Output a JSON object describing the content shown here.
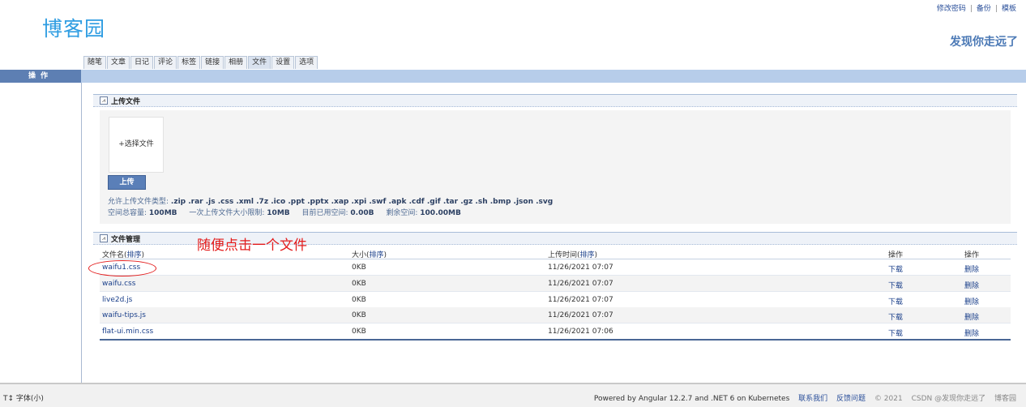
{
  "header": {
    "logo": "博客园",
    "links": [
      "修改密码",
      "备份",
      "模板"
    ],
    "slogan": "发现你走远了"
  },
  "tabs": [
    {
      "label": "随笔",
      "active": false
    },
    {
      "label": "文章",
      "active": false
    },
    {
      "label": "日记",
      "active": false
    },
    {
      "label": "评论",
      "active": false
    },
    {
      "label": "标签",
      "active": false
    },
    {
      "label": "链接",
      "active": false
    },
    {
      "label": "相册",
      "active": false
    },
    {
      "label": "文件",
      "active": true
    },
    {
      "label": "设置",
      "active": false
    },
    {
      "label": "选项",
      "active": false
    }
  ],
  "sidebar": {
    "heading": "操作"
  },
  "upload": {
    "section_title": "上传文件",
    "toggle_icon": "collapse-icon",
    "pick_label": "+选择文件",
    "upload_button": "上传",
    "allowed_label": "允许上传文件类型: ",
    "allowed_types": ".zip .rar .js .css .xml .7z .ico .ppt .pptx .xap .xpi .swf .apk .cdf .gif .tar .gz .sh .bmp .json .svg",
    "quota": [
      {
        "label": "空间总容量: ",
        "value": "100MB"
      },
      {
        "label": "一次上传文件大小限制: ",
        "value": "10MB"
      },
      {
        "label": "目前已用空间: ",
        "value": "0.00B"
      },
      {
        "label": "剩余空间: ",
        "value": "100.00MB"
      }
    ]
  },
  "files": {
    "section_title": "文件管理",
    "annotation": "随便点击一个文件",
    "headers": {
      "name": "文件名(",
      "size": "大小(",
      "time": "上传时间(",
      "sort": "排序",
      "close": ")",
      "op1": "操作",
      "op2": "操作"
    },
    "rows": [
      {
        "name": "waifu1.css",
        "size": "0KB",
        "time": "11/26/2021 07:07",
        "download": "下载",
        "delete": "删除"
      },
      {
        "name": "waifu.css",
        "size": "0KB",
        "time": "11/26/2021 07:07",
        "download": "下载",
        "delete": "删除"
      },
      {
        "name": "live2d.js",
        "size": "0KB",
        "time": "11/26/2021 07:07",
        "download": "下载",
        "delete": "删除"
      },
      {
        "name": "waifu-tips.js",
        "size": "0KB",
        "time": "11/26/2021 07:07",
        "download": "下载",
        "delete": "删除"
      },
      {
        "name": "flat-ui.min.css",
        "size": "0KB",
        "time": "11/26/2021 07:06",
        "download": "下载",
        "delete": "删除"
      }
    ]
  },
  "footer": {
    "font_size": "T↕ 字体(小)",
    "powered": "Powered by Angular 12.2.7 and .NET 6 on Kubernetes",
    "links": [
      "联系我们",
      "反馈问题"
    ],
    "copyright": "© 2021",
    "watermark": "CSDN @发现你走远了",
    "brand": "博客园"
  }
}
